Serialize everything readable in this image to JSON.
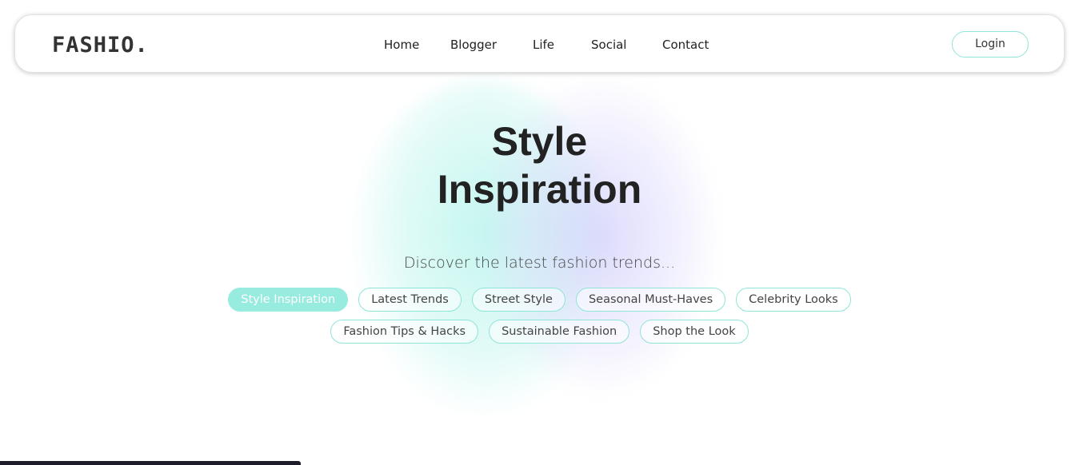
{
  "header": {
    "logo": "FASHIO.",
    "nav": [
      {
        "label": "Home"
      },
      {
        "label": "Blogger"
      },
      {
        "label": "Life"
      },
      {
        "label": "Social"
      },
      {
        "label": "Contact"
      }
    ],
    "login_label": "Login"
  },
  "hero": {
    "title_line1": "Style",
    "title_line2": "Inspiration",
    "subtitle": "Discover the latest fashion trends..."
  },
  "categories": {
    "row1": [
      {
        "label": "Style Inspiration",
        "active": true
      },
      {
        "label": "Latest Trends"
      },
      {
        "label": "Street Style"
      },
      {
        "label": "Seasonal Must-Haves"
      },
      {
        "label": "Celebrity Looks"
      }
    ],
    "row2": [
      {
        "label": "Fashion Tips & Hacks"
      },
      {
        "label": "Sustainable Fashion"
      },
      {
        "label": "Shop the Look"
      }
    ]
  },
  "colors": {
    "accent": "#98ebdf",
    "accent_border": "#8fe5d8",
    "blob_purple": "#d6d3fb",
    "text": "#222222"
  }
}
